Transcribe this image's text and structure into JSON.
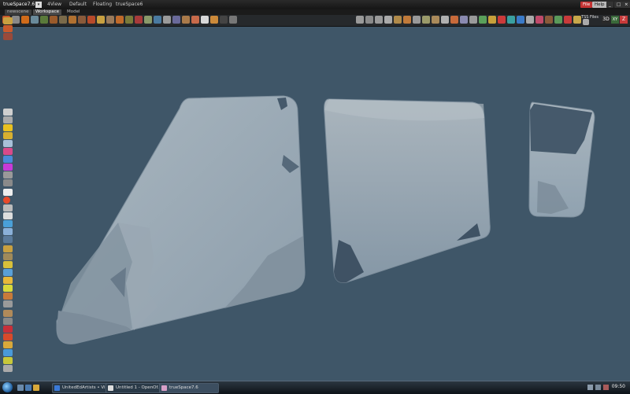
{
  "app": {
    "title": "trueSpace7.6",
    "tabs": [
      "4View",
      "Default",
      "Floating",
      "trueSpace6"
    ],
    "right_buttons": [
      "File",
      "Help"
    ],
    "colors": {
      "file_button": "#c33232",
      "help_button": "#b8b8b8",
      "viewport_bg": "#3f5668"
    }
  },
  "subtabs": [
    "newscene",
    "Workspace",
    "Model"
  ],
  "panel_label": "TSS Files",
  "view_buttons": [
    "3D",
    "XY",
    "Z"
  ],
  "taskbar": {
    "items": [
      "UnitedEdArtists • Vi...",
      "Untitled 1 - OpenOf...",
      "trueSpace7.6"
    ],
    "clock": "09:50"
  }
}
